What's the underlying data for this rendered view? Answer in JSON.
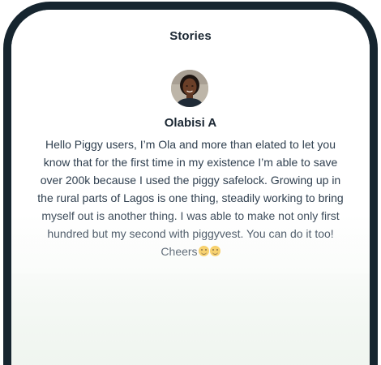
{
  "section": {
    "title": "Stories"
  },
  "story": {
    "author_name": "Olabisi A",
    "avatar_icon": "user-photo",
    "text": "Hello Piggy users, I’m Ola and more than elated to let you know that for the first time in my existence I’m able to save over 200k because I used the piggy safelock. Growing up in the rural parts of Lagos is one thing, steadily working to bring myself out is another thing. I was able to make not only first hundred but my second with piggyvest. You can do it too! Cheers",
    "emoji_icons": [
      "smiling-face-icon",
      "smiling-face-icon"
    ]
  },
  "colors": {
    "frame": "#16252f",
    "heading": "#1b2733",
    "body_text": "#2f3f4f",
    "bottom_tint": "#eef4ee"
  }
}
